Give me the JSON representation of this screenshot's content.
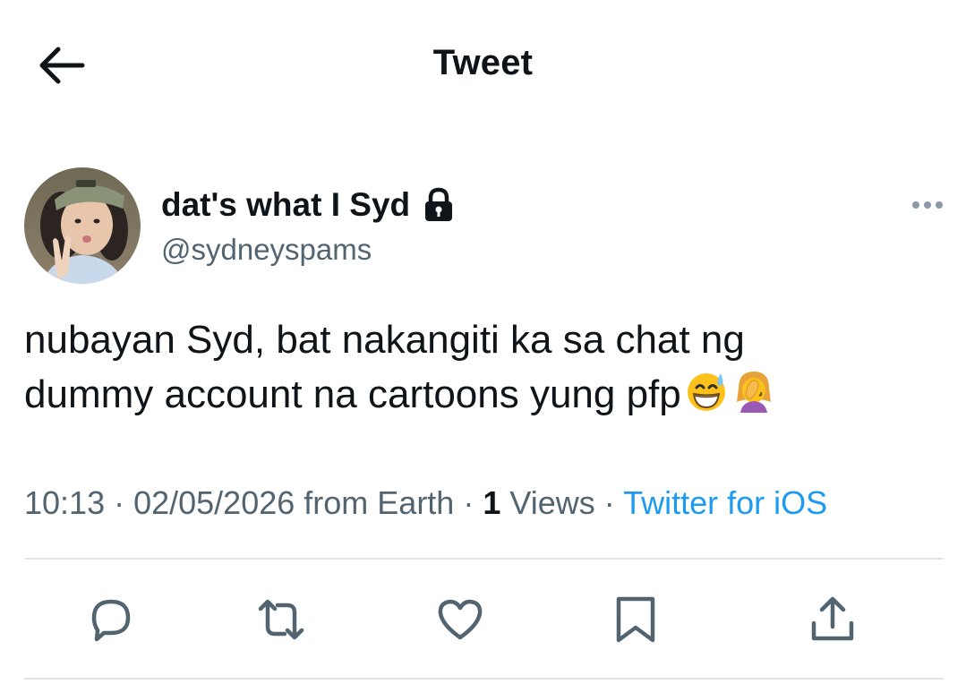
{
  "header": {
    "title": "Tweet"
  },
  "author": {
    "display_name": "dat's what I Syd",
    "handle": "@sydneyspams"
  },
  "tweet": {
    "text_line1": "nubayan Syd, bat nakangiti ka sa chat ng",
    "text_line2": "dummy account na cartoons yung pfp",
    "emojis": [
      "grinning-face-with-sweat-emoji",
      "woman-facepalming-emoji"
    ]
  },
  "meta": {
    "time": "10:13",
    "sep1": " · ",
    "date": "02/05/2026",
    "location": " from Earth",
    "sep2": " · ",
    "views_count": "1",
    "views_label": " Views",
    "sep3": " · ",
    "source": "Twitter for iOS"
  },
  "actions": [
    "reply-icon",
    "retweet-icon",
    "like-icon",
    "bookmark-icon",
    "share-icon"
  ],
  "colors": {
    "text": "#0f1419",
    "secondary": "#536471",
    "link": "#1d9bf0",
    "divider": "#e1e6ea"
  }
}
